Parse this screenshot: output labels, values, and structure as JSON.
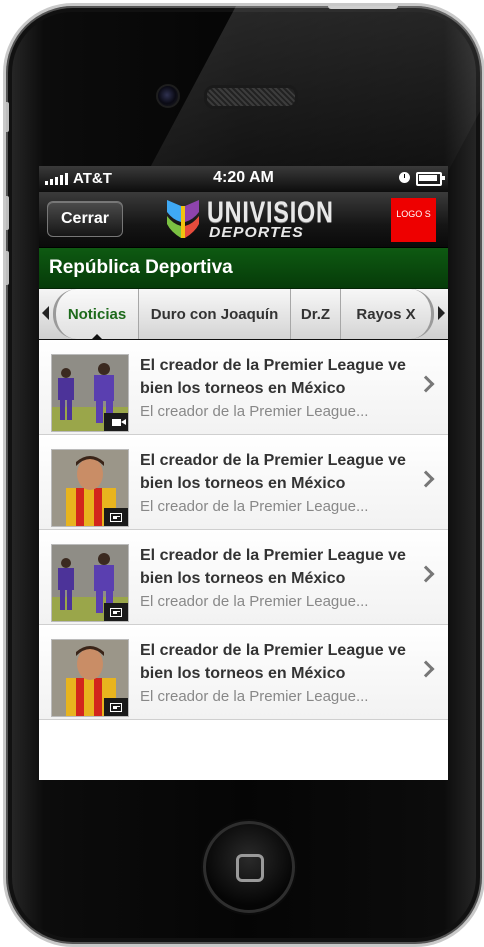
{
  "status_bar": {
    "carrier": "AT&T",
    "time": "4:20 AM"
  },
  "nav": {
    "close_label": "Cerrar",
    "brand_top": "UNIVISION",
    "brand_bottom": "DEPORTES",
    "logo_placeholder": "LOGO S"
  },
  "section": {
    "title": "República Deportiva"
  },
  "tabs": [
    {
      "label": "Noticias"
    },
    {
      "label": "Duro con Joaquín"
    },
    {
      "label": "Dr.Z"
    },
    {
      "label": "Rayos X"
    }
  ],
  "articles": [
    {
      "title": "El creador de la Premier League ve bien los torneos en México",
      "subtitle": "El creador de la Premier League...",
      "media": "video-icon"
    },
    {
      "title": "El creador de la Premier League ve bien los torneos en México",
      "subtitle": "El creador de la Premier League...",
      "media": "article-icon"
    },
    {
      "title": "El creador de la Premier League ve bien los torneos en México",
      "subtitle": "El creador de la Premier League...",
      "media": "article-icon"
    },
    {
      "title": "El creador de la Premier League ve bien los torneos en México",
      "subtitle": "El creador de la Premier League...",
      "media": "article-icon"
    }
  ],
  "colors": {
    "section_green": "#0b4f0f",
    "active_tab_text": "#1d6a1b",
    "logo_red": "#ee0000"
  }
}
